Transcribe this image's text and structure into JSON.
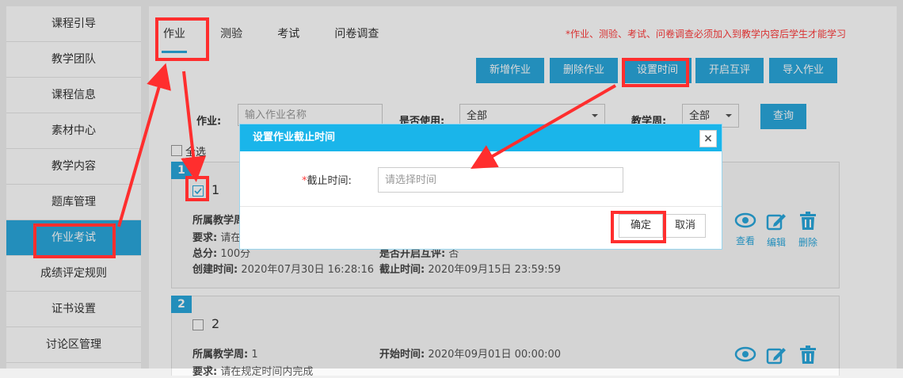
{
  "sidebar": {
    "items": [
      {
        "label": "课程引导"
      },
      {
        "label": "教学团队"
      },
      {
        "label": "课程信息"
      },
      {
        "label": "素材中心"
      },
      {
        "label": "教学内容"
      },
      {
        "label": "题库管理"
      },
      {
        "label": "作业考试"
      },
      {
        "label": "成绩评定规则"
      },
      {
        "label": "证书设置"
      },
      {
        "label": "讨论区管理"
      }
    ]
  },
  "tabs": [
    "作业",
    "测验",
    "考试",
    "问卷调查"
  ],
  "notice": "*作业、测验、考试、问卷调查必须加入到教学内容后学生才能学习",
  "toolbar": {
    "add": "新增作业",
    "delete": "删除作业",
    "set_time": "设置时间",
    "peer_review": "开启互评",
    "import": "导入作业"
  },
  "filters": {
    "homework_label": "作业:",
    "homework_placeholder": "输入作业名称",
    "in_use_label": "是否使用:",
    "in_use_value": "全部",
    "week_label": "教学周:",
    "week_value": "全部",
    "query": "查询"
  },
  "select_all": "全选",
  "cards": [
    {
      "badge": "1",
      "number": "1",
      "week_label": "所属教学周",
      "req_label": "要求:",
      "req_value": "请在",
      "total_label": "总分:",
      "total_value": "100分",
      "created_label": "创建时间:",
      "created_value": "2020年07月30日 16:28:16",
      "peer_label": "是否开启互评:",
      "peer_value": "否",
      "deadline_label": "截止时间:",
      "deadline_value": "2020年09月15日 23:59:59"
    },
    {
      "badge": "2",
      "number": "2",
      "week_label": "所属教学周:",
      "week_value": "1",
      "start_label": "开始时间:",
      "start_value": "2020年09月01日 00:00:00",
      "req_label": "要求:",
      "req_value": "请在规定时间内完成"
    }
  ],
  "actions": {
    "view": "查看",
    "edit": "编辑",
    "delete": "删除"
  },
  "modal": {
    "title": "设置作业截止时间",
    "required_mark": "*",
    "deadline_label": "截止时间:",
    "deadline_placeholder": "请选择时间",
    "ok": "确定",
    "cancel": "取消",
    "close_symbol": "×"
  },
  "colors": {
    "accent": "#2aa7dc",
    "modal_header": "#1ab5ea",
    "highlight": "#ff2e2e"
  }
}
